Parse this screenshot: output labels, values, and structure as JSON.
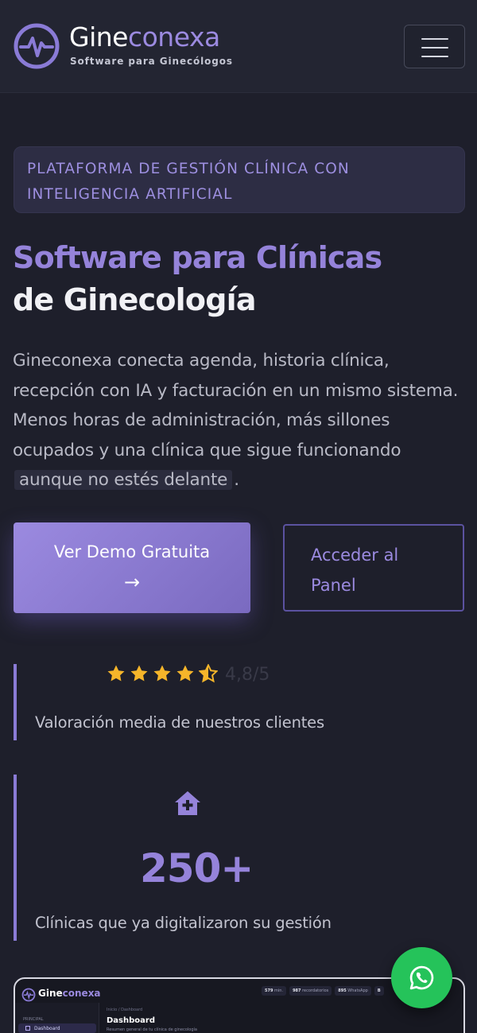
{
  "header": {
    "brand_part1": "Gine",
    "brand_part2": "conexa",
    "tagline": "Software para Ginecólogos",
    "menu_icon": "hamburger-menu-icon",
    "logo_icon": "heartbeat-logo-icon"
  },
  "hero": {
    "badge": "PLATAFORMA DE GESTIÓN CLÍNICA CON INTELIGENCIA ARTIFICIAL",
    "title_line1": "Software para Clínicas",
    "title_line2": "de Ginecología",
    "description": "Gineconexa conecta agenda, historia clínica, recepción con IA y facturación en un mismo sistema. Menos horas de administración, más sillones ocupados y una clínica que sigue funcionando",
    "description_highlight": "aunque no estés delante",
    "description_end": ".",
    "cta_primary": "Ver Demo Gratuita",
    "cta_primary_icon": "arrow-right-icon",
    "cta_secondary": "Acceder al Panel"
  },
  "stats": {
    "rating": {
      "stars": 4.5,
      "value_text": "4,8/5",
      "label": "Valoración media de nuestros clientes"
    },
    "clinics": {
      "icon": "house-medical-icon",
      "value": "250+",
      "label": "Clínicas que ya digitalizaron su gestión"
    }
  },
  "preview": {
    "brand_part1": "Gine",
    "brand_part2": "conexa",
    "pills": [
      {
        "value": "579",
        "unit": "min."
      },
      {
        "value": "987",
        "unit": "recordatorios"
      },
      {
        "value": "895",
        "unit": "WhatsApp"
      },
      {
        "value": "B",
        "unit": ""
      }
    ],
    "section": "PRINCIPAL",
    "nav_item": "Dashboard",
    "breadcrumb": "Inicio  /  Dashboard",
    "title": "Dashboard",
    "subtitle": "Resumen general de tu clínica de ginecología"
  },
  "whatsapp": {
    "icon": "whatsapp-icon"
  },
  "colors": {
    "background": "#1e1f2b",
    "accent": "#9583da",
    "star": "#f5b52a",
    "whatsapp": "#25c35a"
  }
}
